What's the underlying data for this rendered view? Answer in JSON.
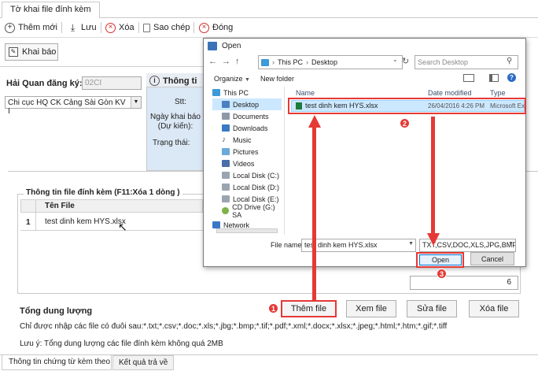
{
  "tab": {
    "title": "Tờ khai file đính kèm"
  },
  "toolbar": {
    "add": "Thêm mới",
    "save": "Lưu",
    "delete": "Xóa",
    "copy": "Sao chép",
    "close": "Đóng"
  },
  "declare_button": "Khai báo",
  "customs": {
    "label": "Hải Quan đăng ký:",
    "code_placeholder": "02CI",
    "selected": "Chi cục HQ CK Cảng Sài Gòn KV I"
  },
  "info": {
    "title": "Thông ti",
    "stt_label": "Stt:",
    "date_label_1": "Ngày khai báo",
    "date_label_2": "(Dự kiến):",
    "status_label": "Trạng thái:"
  },
  "attach": {
    "title": "Thông tin file đính kèm (F11:Xóa 1 dòng )",
    "col_header": "Tên File",
    "rows": [
      {
        "no": "1",
        "name": "test dinh kem HYS.xlsx"
      }
    ],
    "count": "6"
  },
  "size_label": "Tổng dung lượng",
  "buttons": {
    "add_file": "Thêm file",
    "view_file": "Xem file",
    "edit_file": "Sửa file",
    "delete_file": "Xóa file"
  },
  "note_ext": "Chỉ được nhập các file có đuôi sau:*.txt;*.csv;*.doc;*.xls;*.jbg;*.bmp;*.tif;*.pdf;*.xml;*.docx;*.xlsx;*.jpeg;*.html;*.htm;*.gif;*.tiff",
  "note_size": "Lưu ý: Tổng dung lượng các file đính kèm không quá 2MB",
  "bottom_tabs": {
    "tab1": "Thông tin chứng từ kèm theo",
    "tab2": "Kết quả trả về"
  },
  "dialog": {
    "title": "Open",
    "path": [
      "This PC",
      "Desktop"
    ],
    "search_placeholder": "Search Desktop",
    "organize": "Organize",
    "new_folder": "New folder",
    "nav": [
      "This PC",
      "Desktop",
      "Documents",
      "Downloads",
      "Music",
      "Pictures",
      "Videos",
      "Local Disk (C:)",
      "Local Disk (D:)",
      "Local Disk (E:)",
      "CD Drive (G:) SA",
      "Network"
    ],
    "columns": {
      "name": "Name",
      "date": "Date modified",
      "type": "Type"
    },
    "file": {
      "name": "test dinh kem HYS.xlsx",
      "date": "26/04/2016 4:26 PM",
      "type": "Microsoft Ex"
    },
    "filename_label": "File name:",
    "filename_value": "test dinh kem HYS.xlsx",
    "filter": "TXT,CSV,DOC,XLS,JPG,BMP,TIF",
    "open": "Open",
    "cancel": "Cancel"
  },
  "steps": [
    "1",
    "2",
    "3"
  ],
  "colors": {
    "accent": "#e53935",
    "header_blue": "#dbe8f5",
    "selection": "#cce8ff"
  }
}
